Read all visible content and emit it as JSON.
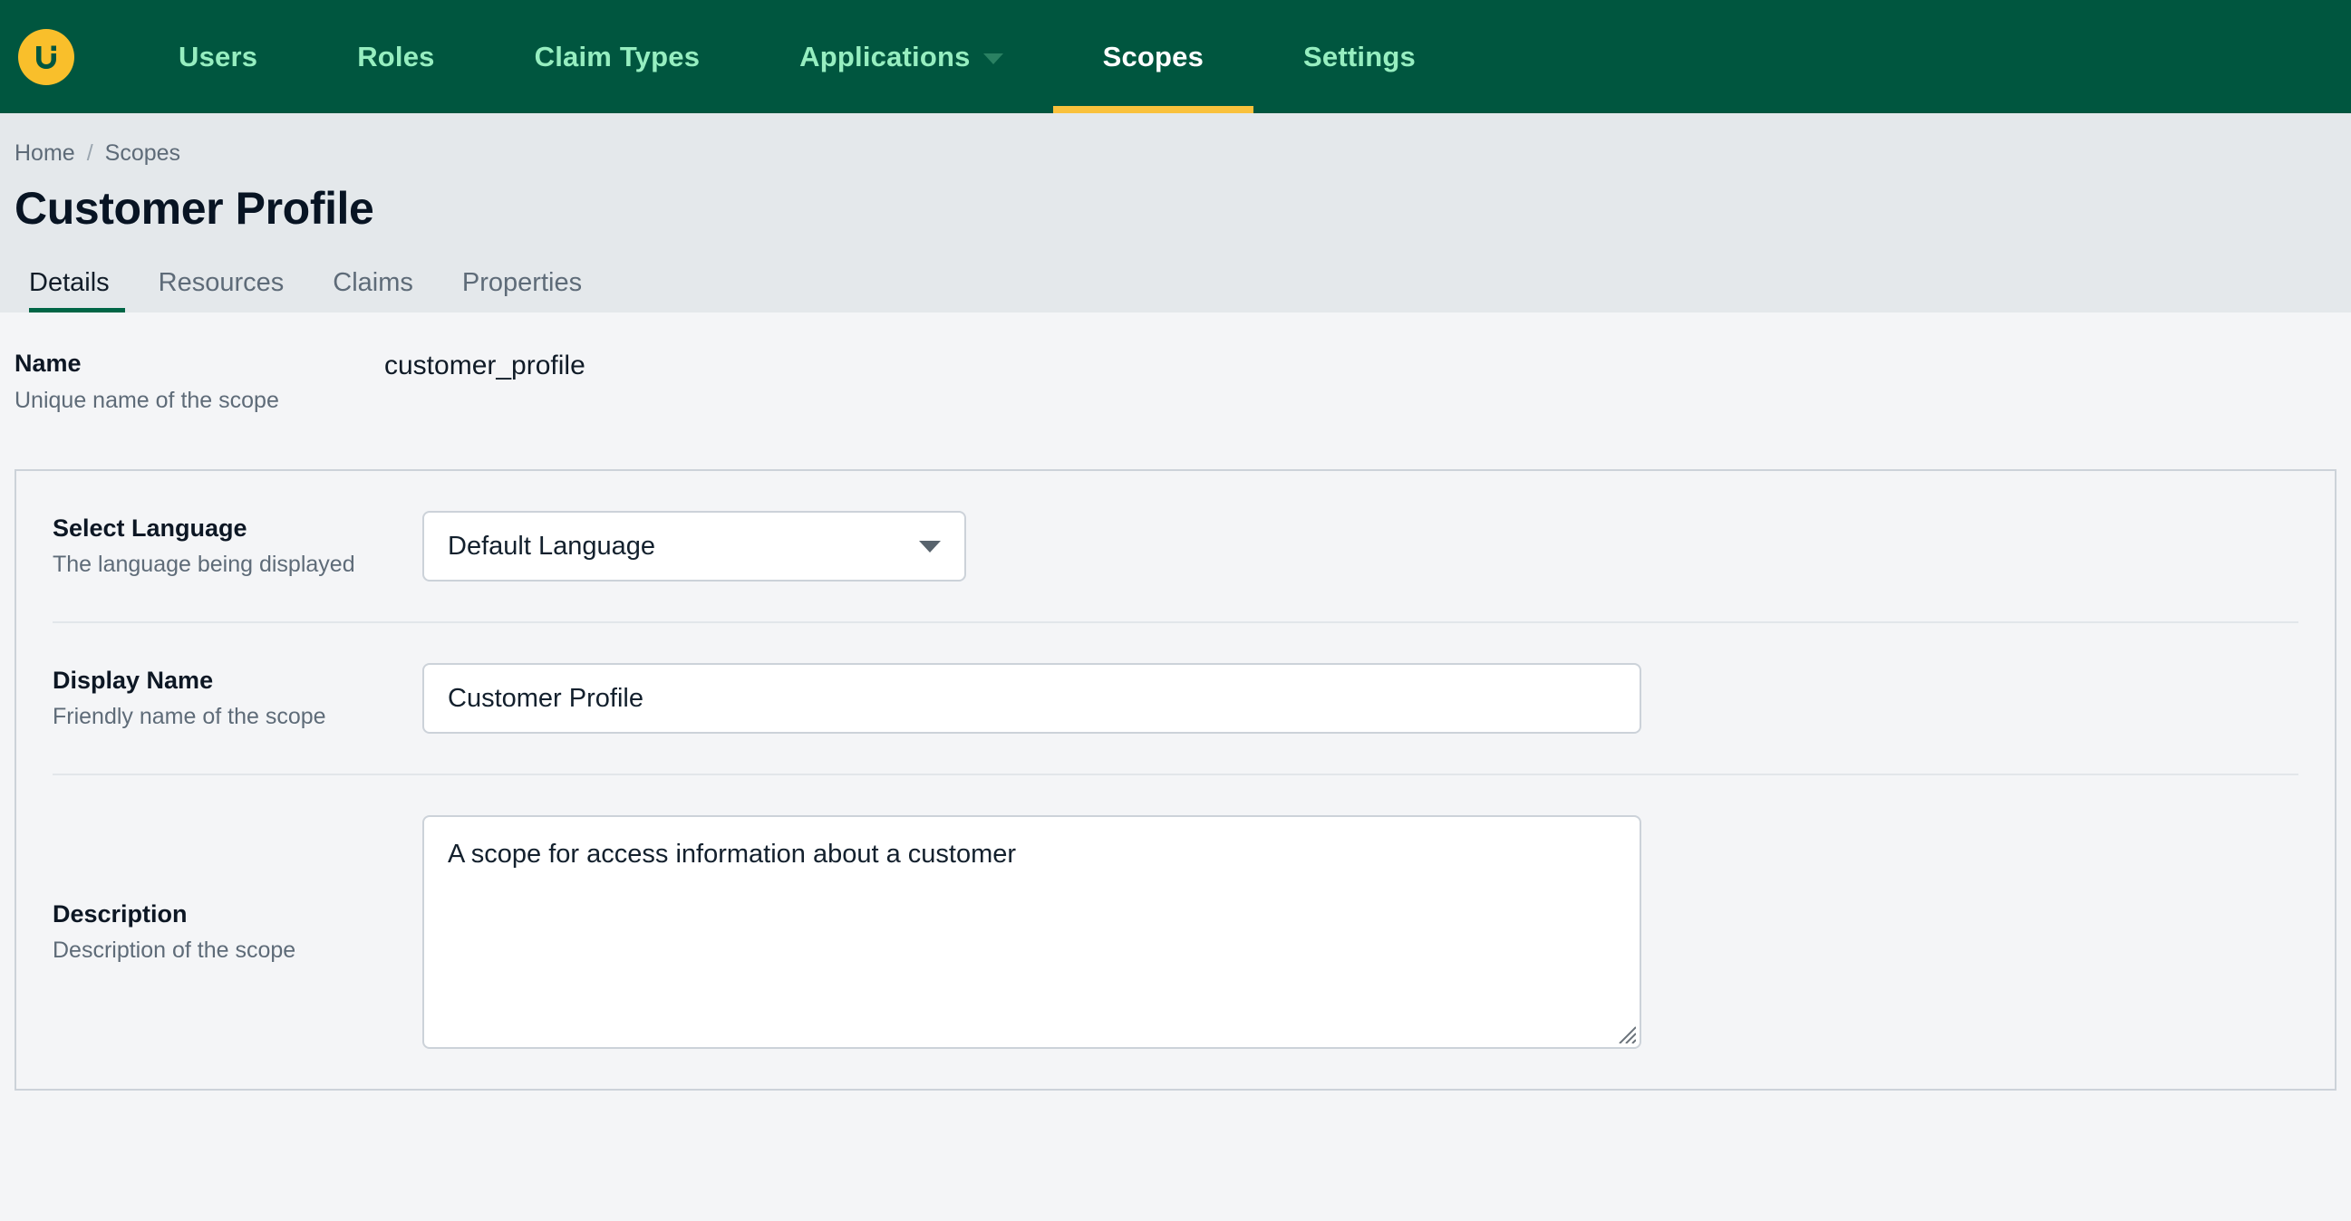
{
  "brand": {
    "logo_icon": "u-circle-logo",
    "logo_bg": "#f9bf2b",
    "logo_fg": "#00563f"
  },
  "topnav": {
    "background": "#00563f",
    "active_underline": "#f9c13c",
    "items": [
      {
        "label": "Users",
        "active": false,
        "has_caret": false
      },
      {
        "label": "Roles",
        "active": false,
        "has_caret": false
      },
      {
        "label": "Claim Types",
        "active": false,
        "has_caret": false
      },
      {
        "label": "Applications",
        "active": false,
        "has_caret": true
      },
      {
        "label": "Scopes",
        "active": true,
        "has_caret": false
      },
      {
        "label": "Settings",
        "active": false,
        "has_caret": false
      }
    ]
  },
  "breadcrumb": {
    "items": [
      "Home",
      "Scopes"
    ],
    "separator": "/"
  },
  "page": {
    "title": "Customer Profile"
  },
  "subtabs": {
    "active_underline": "#006646",
    "items": [
      {
        "label": "Details",
        "active": true
      },
      {
        "label": "Resources",
        "active": false
      },
      {
        "label": "Claims",
        "active": false
      },
      {
        "label": "Properties",
        "active": false
      }
    ]
  },
  "fields": {
    "name": {
      "label": "Name",
      "help": "Unique name of the scope",
      "value": "customer_profile"
    },
    "language": {
      "label": "Select Language",
      "help": "The language being displayed",
      "value": "Default Language",
      "options": [
        "Default Language"
      ],
      "caret_icon": "chevron-down-icon"
    },
    "display_name": {
      "label": "Display Name",
      "help": "Friendly name of the scope",
      "value": "Customer Profile",
      "placeholder": ""
    },
    "description": {
      "label": "Description",
      "help": "Description of the scope",
      "value": "A scope for access information about a customer",
      "placeholder": "",
      "resize_grip_icon": "resize-grip-icon"
    }
  }
}
